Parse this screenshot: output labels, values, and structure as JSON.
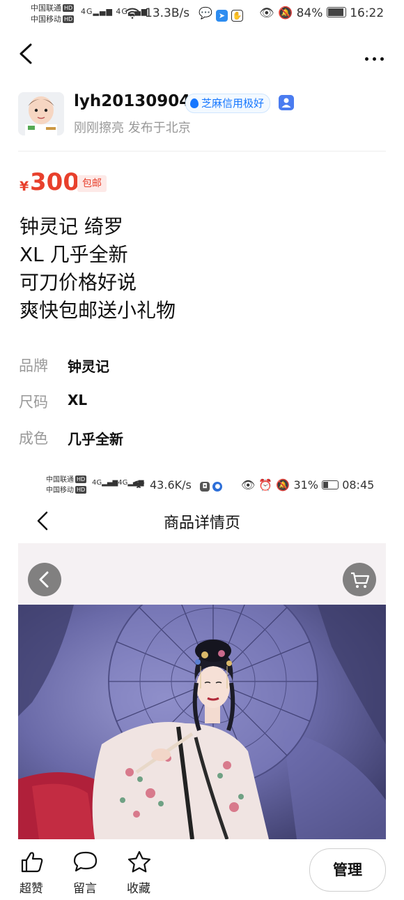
{
  "status_bar": {
    "carrier1": "中国联通",
    "carrier2": "中国移动",
    "hd": "HD",
    "network": "4G",
    "speed": "13.3B/s",
    "battery": "84%",
    "battery_level": 0.84,
    "time": "16:22"
  },
  "seller": {
    "username": "lyh20130904",
    "credit_badge": "芝麻信用极好",
    "subinfo": "刚刚擦亮 发布于北京"
  },
  "price": {
    "currency": "¥",
    "amount": "300",
    "shipping": "包邮"
  },
  "description": [
    "钟灵记 绮罗",
    "XL 几乎全新",
    "可刀价格好说",
    "爽快包邮送小礼物"
  ],
  "attributes": [
    {
      "label": "品牌",
      "value": "钟灵记"
    },
    {
      "label": "尺码",
      "value": "XL"
    },
    {
      "label": "成色",
      "value": "几乎全新"
    }
  ],
  "inner_screenshot": {
    "carrier1": "中国联通",
    "carrier2": "中国移动",
    "hd": "HD",
    "network": "4G",
    "speed": "43.6K/s",
    "battery": "31%",
    "battery_level": 0.31,
    "time": "08:45",
    "title": "商品详情页"
  },
  "bottom_bar": {
    "like": "超赞",
    "comment": "留言",
    "favorite": "收藏",
    "manage": "管理"
  },
  "colors": {
    "price_red": "#e8402c",
    "credit_blue": "#1677ff"
  }
}
